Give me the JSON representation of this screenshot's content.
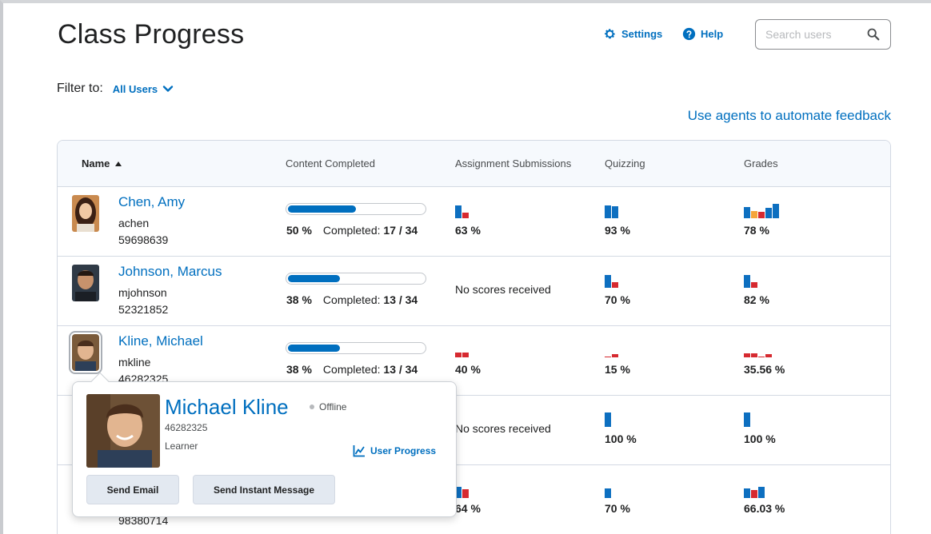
{
  "header": {
    "title": "Class Progress",
    "settings_label": "Settings",
    "help_label": "Help",
    "search_placeholder": "Search users"
  },
  "filter": {
    "label": "Filter to:",
    "value": "All Users"
  },
  "agents_link": "Use agents to automate feedback",
  "table": {
    "columns": [
      "Name",
      "Content Completed",
      "Assignment Submissions",
      "Quizzing",
      "Grades"
    ],
    "completed_label": "Completed:",
    "rows": [
      {
        "name": "Chen, Amy",
        "username": "achen",
        "org_id": "59698639",
        "content_pct": "50 %",
        "content_fraction": 0.5,
        "completed": "17 / 34",
        "assignments": "63 %",
        "quizzing": "93 %",
        "grades": "78 %"
      },
      {
        "name": "Johnson, Marcus",
        "username": "mjohnson",
        "org_id": "52321852",
        "content_pct": "38 %",
        "content_fraction": 0.38,
        "completed": "13 / 34",
        "assignments": "No scores received",
        "quizzing": "70 %",
        "grades": "82 %"
      },
      {
        "name": "Kline, Michael",
        "username": "mkline",
        "org_id": "46282325",
        "content_pct": "38 %",
        "content_fraction": 0.38,
        "completed": "13 / 34",
        "assignments": "40 %",
        "quizzing": "15 %",
        "grades": "35.56 %"
      },
      {
        "assignments": "No scores received",
        "quizzing": "100 %",
        "grades": "100 %"
      },
      {
        "org_id": "98380714",
        "assignments": "64 %",
        "quizzing": "70 %",
        "grades": "66.03 %"
      }
    ]
  },
  "popup": {
    "name": "Michael Kline",
    "status": "Offline",
    "org_id": "46282325",
    "role": "Learner",
    "progress_link": "User Progress",
    "email_button": "Send Email",
    "im_button": "Send Instant Message"
  },
  "colors": {
    "accent": "#006fbf",
    "bar_blue": "#0d6fc0",
    "bar_red": "#d62a30",
    "bar_orange": "#f5a43a"
  }
}
